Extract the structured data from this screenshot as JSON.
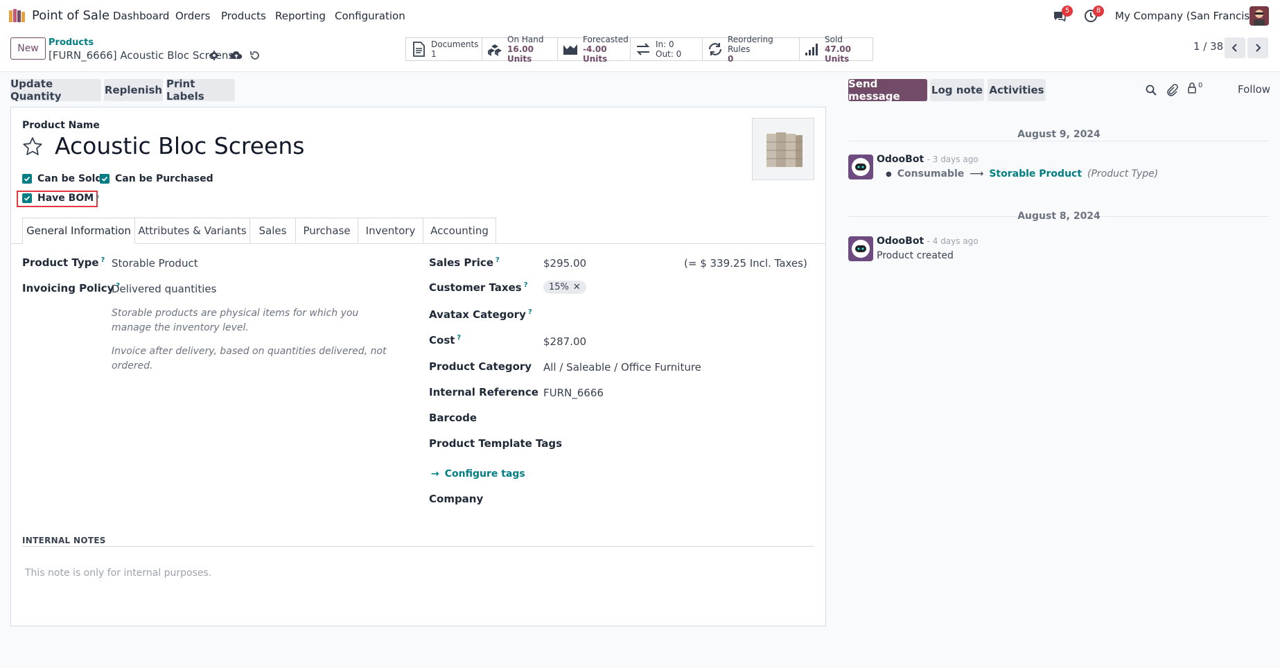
{
  "navbar": {
    "app_name": "Point of Sale",
    "menu": [
      "Dashboard",
      "Orders",
      "Products",
      "Reporting",
      "Configuration"
    ],
    "messages_count": "5",
    "activities_count": "8",
    "company": "My Company (San Francisco)"
  },
  "control_panel": {
    "new_label": "New",
    "breadcrumb_parent": "Products",
    "record_title": "[FURN_6666] Acoustic Bloc Screens",
    "smart_buttons": [
      {
        "line1": "Documents",
        "line2": "1"
      },
      {
        "line1": "On Hand",
        "line2": "16.00 Units"
      },
      {
        "line1": "Forecasted",
        "line2": "-4.00 Units"
      },
      {
        "line1": "In: 0",
        "line2": "Out: 0"
      },
      {
        "line1": "Reordering Rules",
        "line2": "0"
      },
      {
        "line1": "Sold",
        "line2": "47.00 Units"
      }
    ],
    "pager": "1 / 38"
  },
  "actions": {
    "update_quantity": "Update Quantity",
    "replenish": "Replenish",
    "print_labels": "Print Labels"
  },
  "form": {
    "product_name_label": "Product Name",
    "product_name": "Acoustic Bloc Screens",
    "can_be_sold": "Can be Sold",
    "can_be_purchased": "Can be Purchased",
    "have_bom": "Have BOM",
    "tabs": [
      "General Information",
      "Attributes & Variants",
      "Sales",
      "Purchase",
      "Inventory",
      "Accounting"
    ],
    "left": {
      "product_type_label": "Product Type",
      "product_type": "Storable Product",
      "invoicing_policy_label": "Invoicing Policy",
      "invoicing_policy": "Delivered quantities",
      "note1": "Storable products are physical items for which you manage the inventory level.",
      "note2": "Invoice after delivery, based on quantities delivered, not ordered."
    },
    "right": {
      "sales_price_label": "Sales Price",
      "sales_price": "$295.00",
      "incl_taxes": "(= $ 339.25 Incl. Taxes)",
      "customer_taxes_label": "Customer Taxes",
      "customer_tax_tag": "15%",
      "avatax_label": "Avatax Category",
      "cost_label": "Cost",
      "cost": "$287.00",
      "category_label": "Product Category",
      "category": "All / Saleable / Office Furniture",
      "internal_ref_label": "Internal Reference",
      "internal_ref": "FURN_6666",
      "barcode_label": "Barcode",
      "template_tags_label": "Product Template Tags",
      "configure_tags": "Configure tags",
      "company_label": "Company"
    },
    "internal_notes_title": "INTERNAL NOTES",
    "internal_notes_placeholder": "This note is only for internal purposes."
  },
  "chatter": {
    "send_message": "Send message",
    "log_note": "Log note",
    "activities": "Activities",
    "followers_count": "0",
    "follow": "Follow",
    "entries": [
      {
        "date": "August 9, 2024",
        "author": "OdooBot",
        "time": "- 3 days ago",
        "old_value": "Consumable",
        "new_value": "Storable Product",
        "field": "(Product Type)"
      },
      {
        "date": "August 8, 2024",
        "author": "OdooBot",
        "time": "- 4 days ago",
        "body": "Product created"
      }
    ]
  }
}
